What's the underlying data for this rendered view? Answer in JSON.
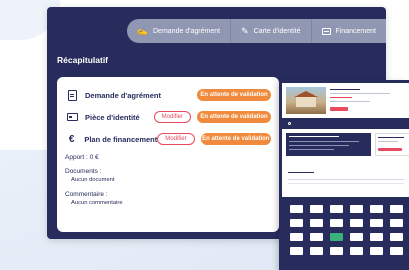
{
  "tabs": [
    {
      "label": "Demande d'agrément",
      "icon": "handshake-icon"
    },
    {
      "label": "Carte d'identité",
      "icon": "id-card-icon"
    },
    {
      "label": "Financement",
      "icon": "bill-icon"
    }
  ],
  "recap": {
    "title": "Récapitulatif",
    "rows": [
      {
        "label": "Demande d'agrément",
        "status": "En attente de validation",
        "icon": "document-icon"
      },
      {
        "label": "Pièce d'identité",
        "modify": "Modifier",
        "status": "En attente de validation",
        "icon": "id-card-icon"
      },
      {
        "label": "Plan de financement",
        "modify": "Modifier",
        "status": "En attente de validation",
        "icon": "euro-icon"
      }
    ],
    "apport": "Apport : 0 €",
    "documents_label": "Documents :",
    "documents_value": "Aucun document",
    "commentaire_label": "Commentaire :",
    "commentaire_value": "Aucun commentaire"
  },
  "colors": {
    "navy": "#272c5d",
    "tab": "#9097b2",
    "orange": "#f08a3c",
    "red": "#e84a5f",
    "green": "#3ab07a"
  }
}
